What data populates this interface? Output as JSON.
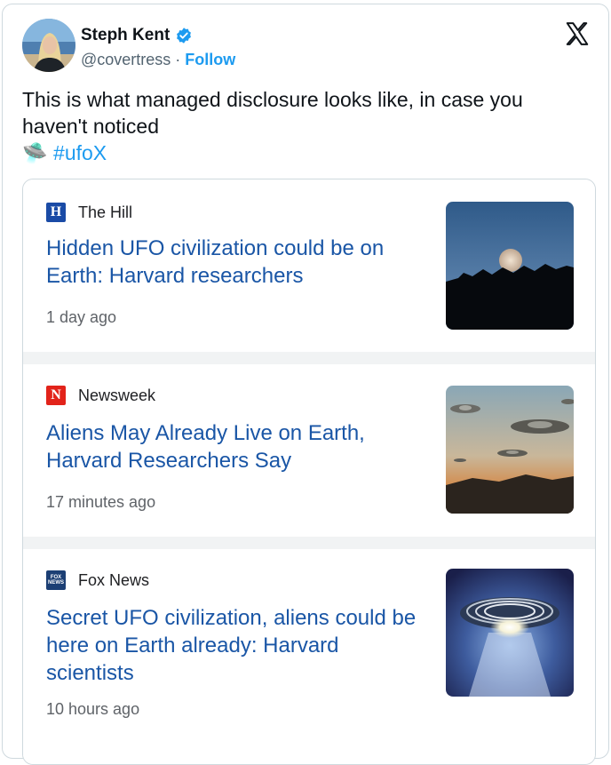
{
  "author": {
    "name": "Steph Kent",
    "handle": "@covertress",
    "separator": " · ",
    "follow_label": "Follow"
  },
  "tweet": {
    "text": "This is what managed disclosure looks like, in case you haven't noticed",
    "emoji": "🛸",
    "hashtag": "#ufoX"
  },
  "stories": [
    {
      "source": "The Hill",
      "source_icon_letter": "H",
      "source_icon_color": "#1a4ba6",
      "headline": "Hidden UFO civilization could be on Earth: Harvard researchers",
      "time": "1 day ago",
      "thumb": "moon-over-hills-image"
    },
    {
      "source": "Newsweek",
      "source_icon_letter": "N",
      "source_icon_color": "#e2231a",
      "headline": "Aliens May Already Live on Earth, Harvard Researchers Say",
      "time": "17 minutes ago",
      "thumb": "flying-saucers-sunset-image"
    },
    {
      "source": "Fox News",
      "source_icon_letter": "FOX NEWS",
      "source_icon_color": "#1c3f74",
      "headline": "Secret UFO civilization, aliens could be here on Earth already: Harvard scientists",
      "time": "10 hours ago",
      "thumb": "glowing-ufo-image"
    }
  ],
  "colors": {
    "link": "#1d9bf0",
    "headline": "#1a56a6"
  }
}
